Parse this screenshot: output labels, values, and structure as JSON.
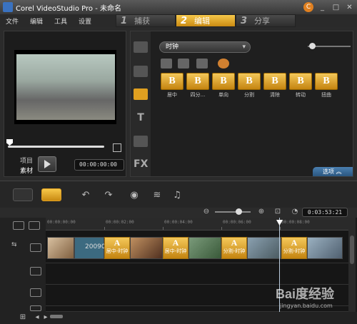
{
  "app": {
    "title": "Corel VideoStudio Pro - 未命名"
  },
  "menu": [
    "文件",
    "编辑",
    "工具",
    "设置"
  ],
  "steps": [
    {
      "num": "1",
      "label": "捕获"
    },
    {
      "num": "2",
      "label": "编辑"
    },
    {
      "num": "3",
      "label": "分享"
    }
  ],
  "preview": {
    "mode_project": "项目",
    "mode_clip": "素材",
    "timecode": "00:00:00:00"
  },
  "library": {
    "category": "时钟",
    "transitions": [
      "居中",
      "四分...",
      "单向",
      "分割",
      "清除",
      "转动",
      "扭曲"
    ],
    "options_label": "选项"
  },
  "timeline": {
    "total_time": "0:03:53:21",
    "ruler_ticks": [
      "00:00:00:00",
      "00:00:02:00",
      "00:00:04:00",
      "00:00:06:00",
      "00:00:08:00"
    ],
    "clip_text": "20090",
    "transition_clips": [
      "居中-时钟",
      "居中-时钟",
      "分割-时钟",
      "分割-时钟"
    ]
  },
  "watermark": {
    "title": "Bai度经验",
    "url": "jingyan.baidu.com"
  },
  "colors": {
    "accent": "#e0a020",
    "options": "#3a6f9f"
  }
}
